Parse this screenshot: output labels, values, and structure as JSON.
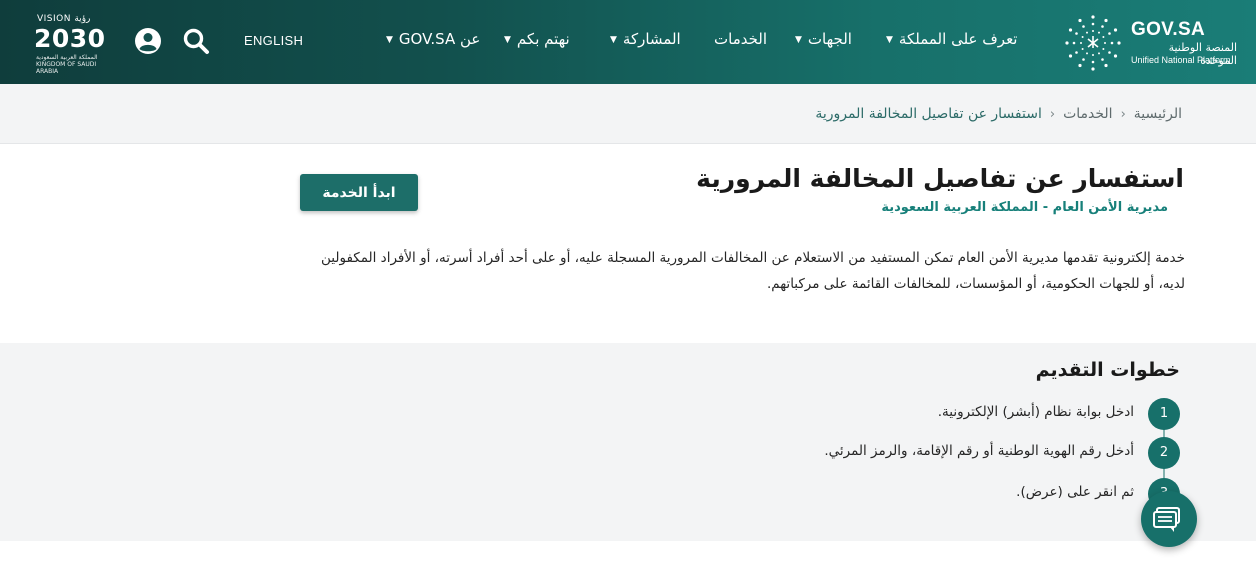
{
  "header": {
    "vision": {
      "line1": "VISION رؤية",
      "line2": "2030",
      "line3": "المملكة العربية السعودية KINGDOM OF SAUDI ARABIA"
    },
    "language_label": "ENGLISH",
    "nav": [
      {
        "label": "عن GOV.SA",
        "has_dropdown": true
      },
      {
        "label": "نهتم بكم",
        "has_dropdown": true
      },
      {
        "label": "المشاركة",
        "has_dropdown": true
      },
      {
        "label": "الخدمات",
        "has_dropdown": false
      },
      {
        "label": "الجهات",
        "has_dropdown": true
      },
      {
        "label": "تعرف على المملكة",
        "has_dropdown": true
      }
    ],
    "logo": {
      "title": "GOV.SA",
      "subtitle_ar": "المنصة الوطنية الموحدة",
      "subtitle_en": "Unified National Platform"
    }
  },
  "breadcrumb": {
    "items": [
      "الرئيسية",
      "الخدمات",
      "استفسار عن تفاصيل المخالفة المرورية"
    ],
    "separator": "‹"
  },
  "service": {
    "title": "استفسار عن تفاصيل المخالفة المرورية",
    "provider": "مديرية الأمن العام - المملكة العربية السعودية",
    "start_button": "ابدأ الخدمة",
    "description": "خدمة إلكترونية تقدمها مديرية الأمن العام تمكن المستفيد من الاستعلام عن المخالفات المرورية المسجلة عليه، أو على أحد أفراد أسرته، أو الأفراد المكفولين لديه، أو للجهات الحكومية، أو المؤسسات، للمخالفات القائمة على مركباتهم."
  },
  "steps": {
    "title": "خطوات التقديم",
    "items": [
      {
        "number": "1",
        "text": "ادخل بوابة نظام (أبشر) الإلكترونية."
      },
      {
        "number": "2",
        "text": "أدخل رقم الهوية الوطنية أو رقم الإقامة، والرمز المرئي."
      },
      {
        "number": "3",
        "text": "ثم انقر على (عرض)."
      }
    ]
  },
  "colors": {
    "primary": "#17706a",
    "header_dark": "#0f3d3c",
    "accent_text": "#17807a"
  },
  "icons": {
    "user": "user-icon",
    "search": "search-icon",
    "chat": "chat-icon",
    "dropdown": "caret-down-icon"
  }
}
